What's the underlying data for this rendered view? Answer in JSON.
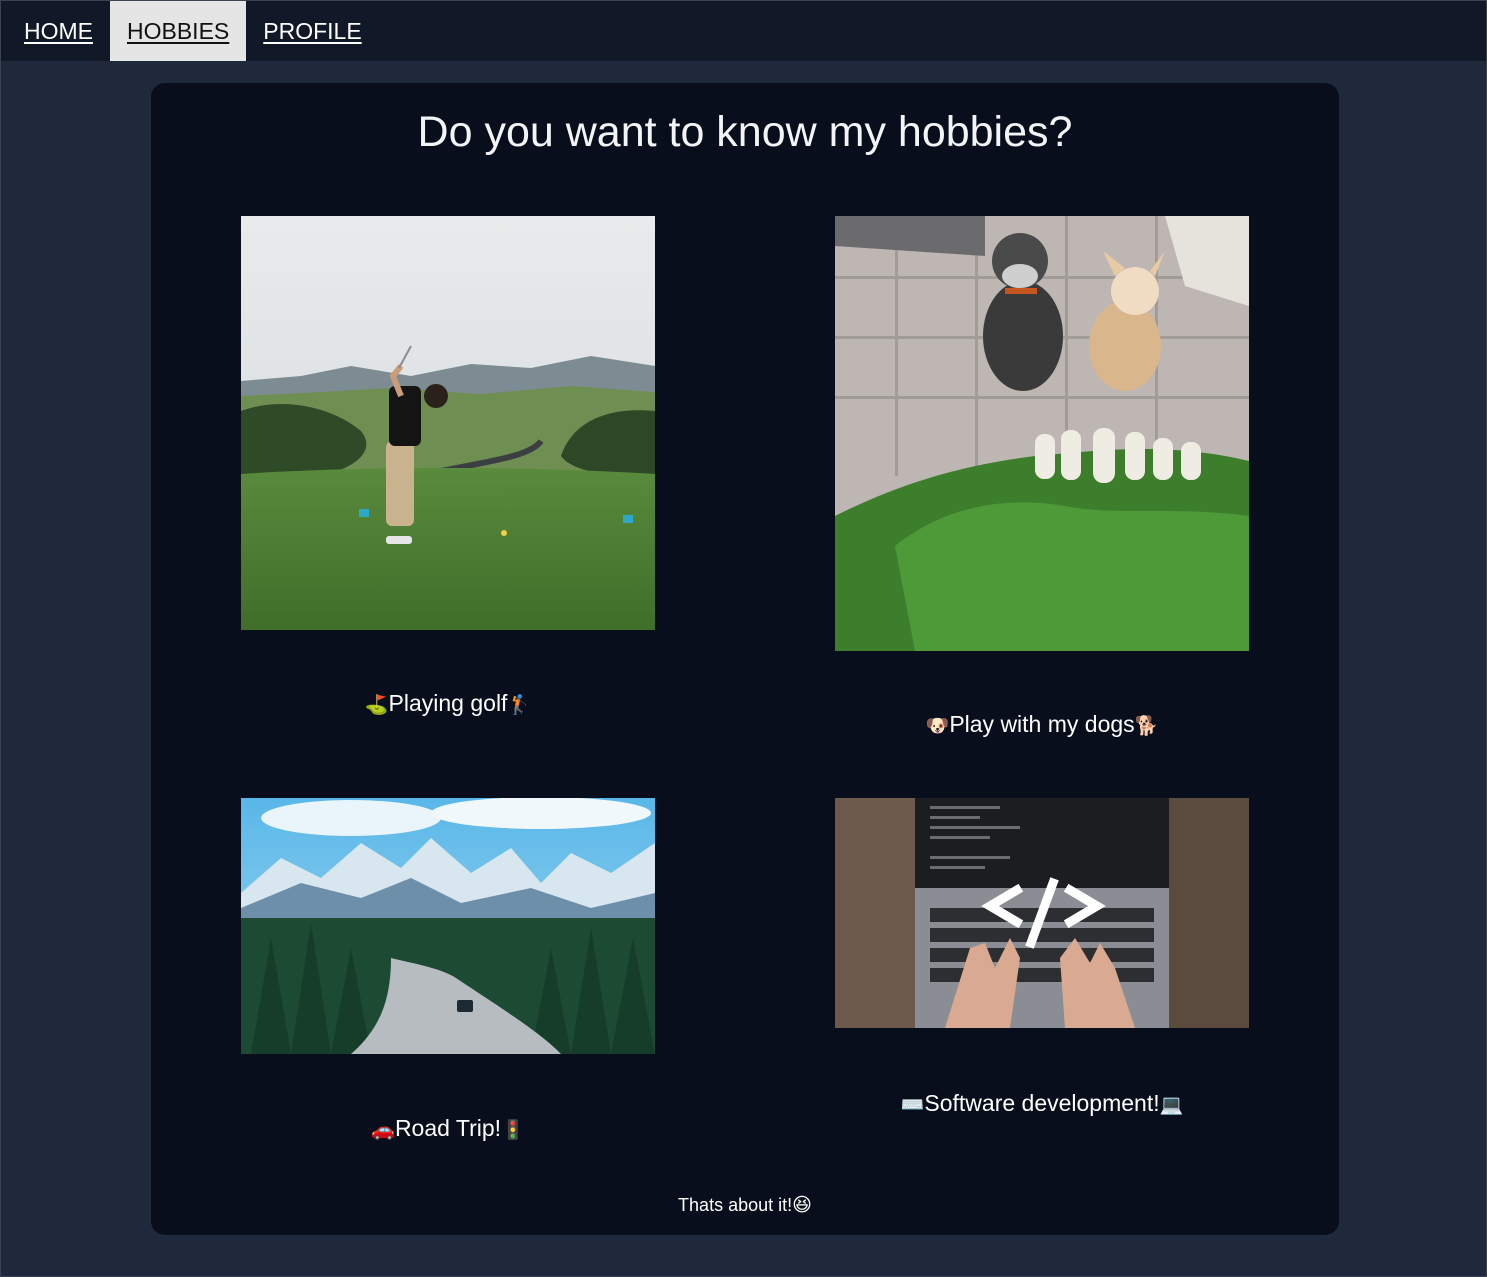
{
  "nav": {
    "items": [
      {
        "label": "HOME",
        "active": false
      },
      {
        "label": "HOBBIES",
        "active": true
      },
      {
        "label": "PROFILE",
        "active": false
      }
    ]
  },
  "page": {
    "title": "Do you want to know my hobbies?",
    "footer_text": "Thats about it!",
    "footer_emoji": "😆"
  },
  "hobbies": [
    {
      "emoji_before": "⛳",
      "label": "Playing golf",
      "emoji_after": "🏌️",
      "image": "golfer-on-course-photo"
    },
    {
      "emoji_before": "🐶",
      "label": "Play with my dogs",
      "emoji_after": "🐕",
      "image": "two-dogs-with-radishes-photo"
    },
    {
      "emoji_before": "🚗",
      "label": "Road Trip!",
      "emoji_after": "🚦",
      "image": "mountain-road-photo"
    },
    {
      "emoji_before": "⌨️",
      "label": "Software development!",
      "emoji_after": "💻",
      "image": "laptop-coding-photo"
    }
  ],
  "colors": {
    "page_bg": "#1f293b",
    "nav_bg": "#111827",
    "card_bg": "#080e1b",
    "active_tab_bg": "#e5e5e5"
  }
}
